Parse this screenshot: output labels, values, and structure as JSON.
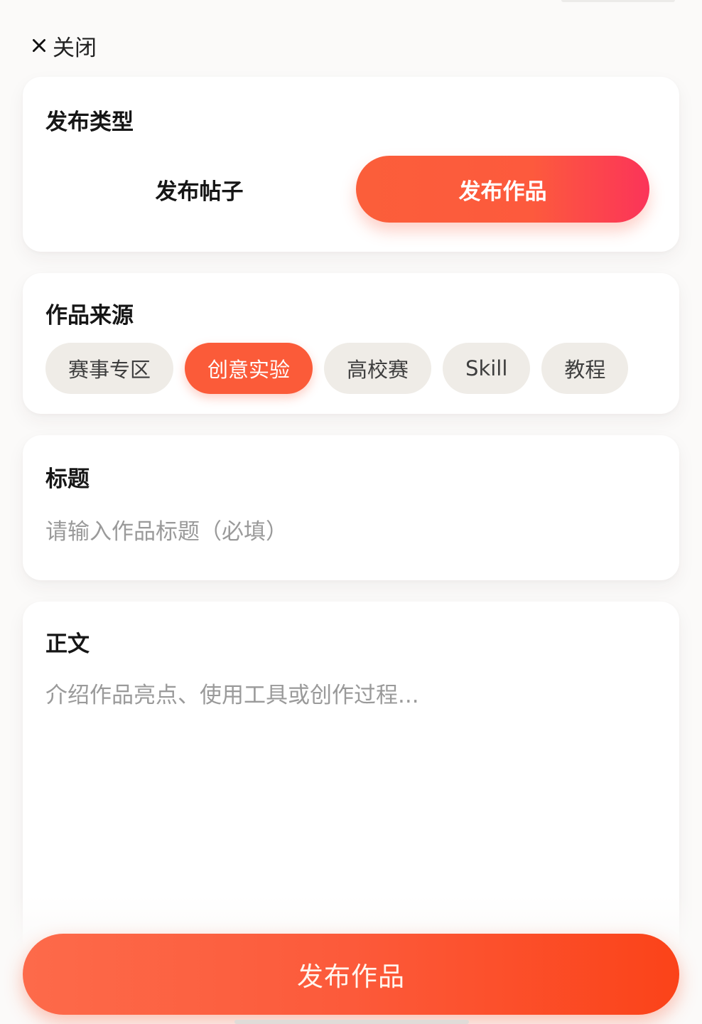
{
  "header": {
    "close_label": "关闭",
    "close_icon": "close-icon"
  },
  "publish_type": {
    "title": "发布类型",
    "options": [
      {
        "label": "发布帖子",
        "selected": false
      },
      {
        "label": "发布作品",
        "selected": true
      }
    ]
  },
  "source": {
    "title": "作品来源",
    "chips": [
      {
        "label": "赛事专区",
        "selected": false
      },
      {
        "label": "创意实验",
        "selected": true
      },
      {
        "label": "高校赛",
        "selected": false
      },
      {
        "label": "Skill",
        "selected": false
      },
      {
        "label": "教程",
        "selected": false
      }
    ]
  },
  "title_field": {
    "title": "标题",
    "value": "",
    "placeholder": "请输入作品标题（必填）"
  },
  "body_field": {
    "title": "正文",
    "value": "",
    "placeholder": "介绍作品亮点、使用工具或创作过程..."
  },
  "submit": {
    "label": "发布作品"
  },
  "colors": {
    "accent": "#fb5b39",
    "chip_bg": "#efece7",
    "placeholder": "#9a9a9a"
  }
}
